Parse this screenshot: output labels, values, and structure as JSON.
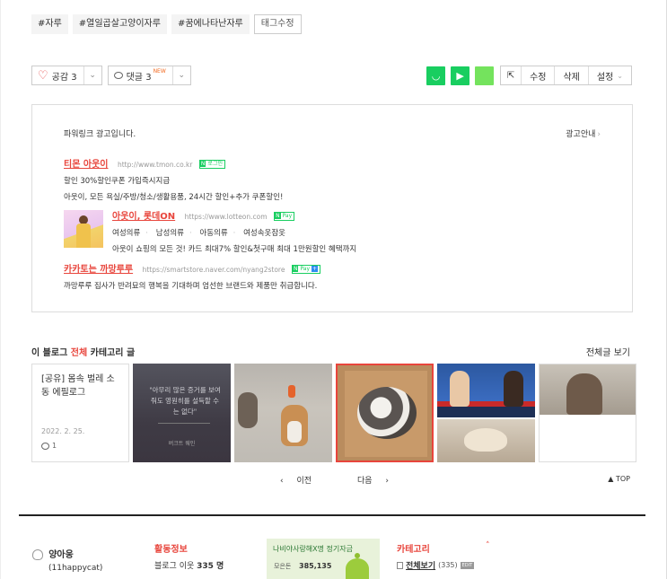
{
  "tags": [
    "#자루",
    "#열일곱살고양이자루",
    "#꿈에나타난자루"
  ],
  "tag_edit": "태그수정",
  "actions": {
    "like": "공감 3",
    "comment": "댓글 3",
    "new_badge": "NEW",
    "edit": "수정",
    "delete": "삭제",
    "settings": "설정"
  },
  "powerlink": {
    "header": "파워링크 광고입니다.",
    "guide": "광고안내",
    "ads": [
      {
        "title": "티몬 아웃이",
        "url": "http://www.tmon.co.kr",
        "badge": "로그인",
        "lines": [
          "할인  30%할인쿠폰 가입즉시지급",
          "아웃이, 모든 욕실/주방/청소/생활용품, 24시간 할인+추가 쿠폰할인!"
        ]
      },
      {
        "title": "아웃이, 롯데ON",
        "url": "https://www.lotteon.com",
        "badge": "Pay",
        "tabs": [
          "여성의류",
          "남성의류",
          "아동의류",
          "여성속옷잠옷"
        ],
        "lines": [
          "아웃이 쇼핑의 모든 것! 카드 최대7% 할인&첫구매 최대 1만원할인 혜택까지"
        ]
      },
      {
        "title": "카카토는 까망루루",
        "url": "https://smartstore.naver.com/nyang2store",
        "badge": "Pay",
        "lines": [
          "까망루루 집사가 반려묘의 행복을 기대하며 엄선한 브랜드와 제품만 취급합니다."
        ]
      }
    ]
  },
  "category": {
    "title_prefix": "이 블로그",
    "title_red": "전체",
    "title_suffix": "카테고리 글",
    "view_all": "전체글 보기",
    "card_text": {
      "title": "[공유] 몸속 벌레 소동 에필로그",
      "date": "2022. 2. 25.",
      "comments": "1"
    },
    "card_quote": "\"아무리 많은 증거를 보여줘도 영원히를 설득할 수는 없다\"",
    "card_quote_sig": "버크트 웨인",
    "pager": {
      "prev": "이전",
      "next": "다음"
    },
    "top": "TOP"
  },
  "footer": {
    "nickname": "양아웅",
    "handle": "(11happycat)",
    "activity_header": "활동정보",
    "neighbors_label": "블로그 이웃",
    "neighbors_count": "335 명",
    "banner_title": "나비야사랑해X명 정기자금",
    "banner_sub": "모은돈",
    "banner_num": "385,135",
    "category_header": "카테고리",
    "category_item": "전체보기",
    "category_count": "(335)",
    "category_edit": "EDIT"
  },
  "colors": {
    "accent_red": "#e8453c",
    "naver_green": "#19ce60"
  }
}
